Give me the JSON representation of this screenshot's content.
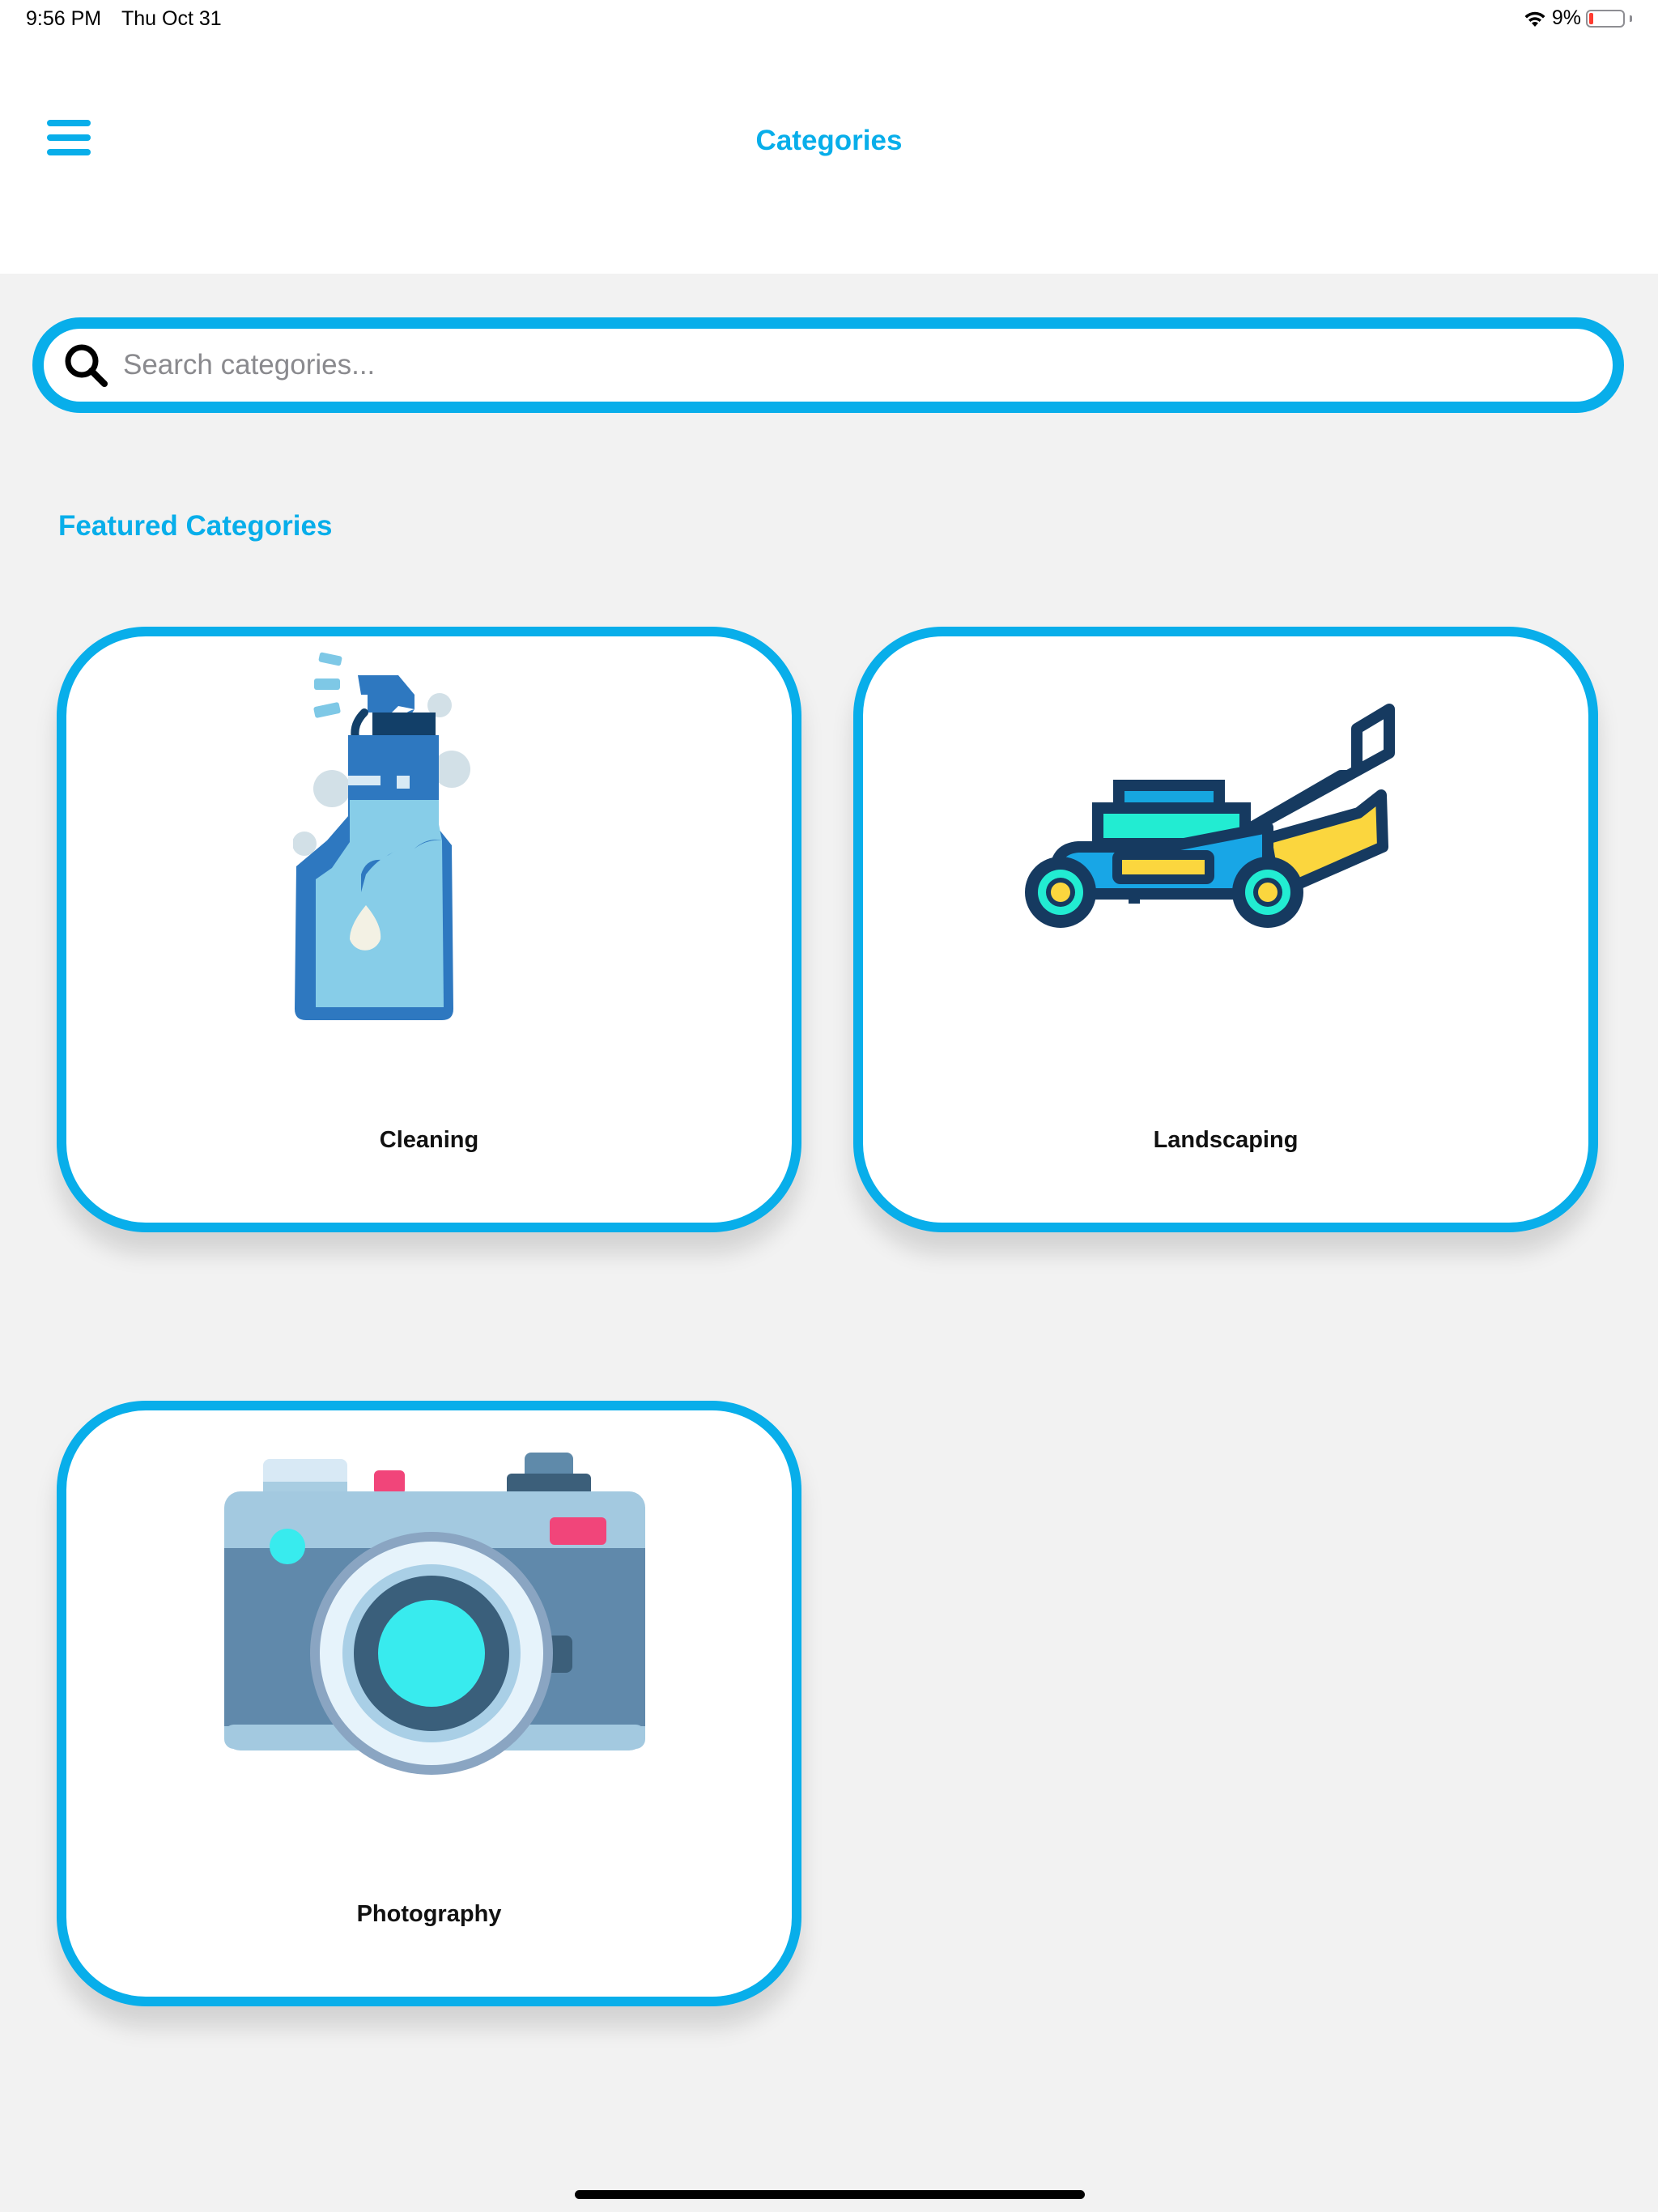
{
  "status_bar": {
    "time": "9:56 PM",
    "date": "Thu Oct 31",
    "battery": "9%",
    "battery_level": 0.09,
    "wifi_icon": "wifi-icon",
    "battery_icon": "battery-icon"
  },
  "header": {
    "title": "Categories",
    "menu_icon": "hamburger-menu-icon"
  },
  "search": {
    "placeholder": "Search categories...",
    "value": "",
    "icon": "search-icon"
  },
  "featured": {
    "title": "Featured Categories",
    "categories": [
      {
        "label": "Cleaning",
        "icon": "spray-bottle-icon"
      },
      {
        "label": "Landscaping",
        "icon": "lawn-mower-icon"
      },
      {
        "label": "Photography",
        "icon": "camera-icon"
      }
    ]
  },
  "colors": {
    "accent": "#08aeea",
    "background": "#f2f2f2",
    "card": "#ffffff"
  }
}
